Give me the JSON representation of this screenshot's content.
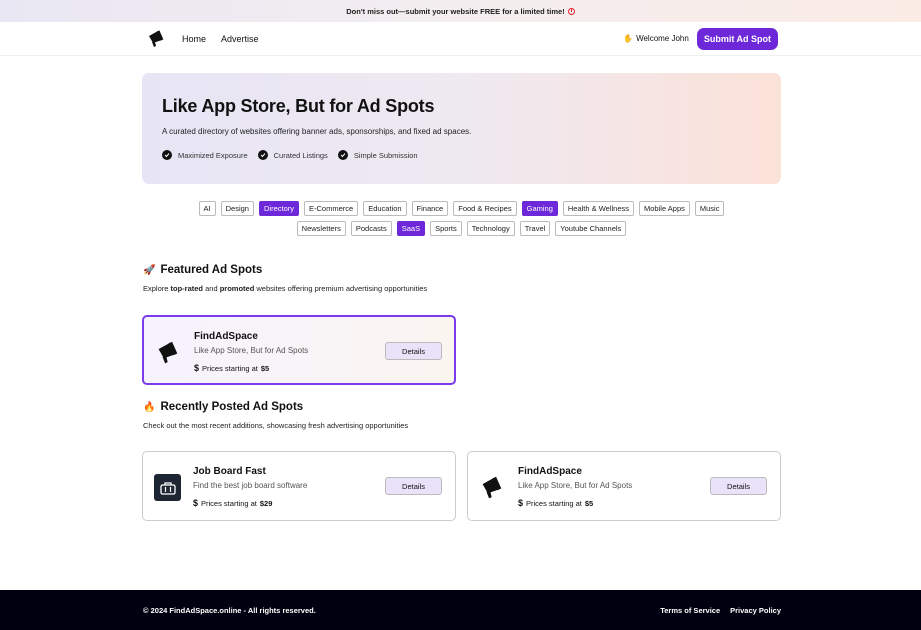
{
  "banner": {
    "text": "Don't miss out—submit your website FREE for a limited time!"
  },
  "nav": {
    "home": "Home",
    "advertise": "Advertise",
    "welcome": "Welcome John",
    "submit": "Submit Ad Spot"
  },
  "hero": {
    "title": "Like App Store, But for Ad Spots",
    "subtitle": "A curated directory of websites offering banner ads, sponsorships, and fixed ad spaces.",
    "features": [
      "Maximized Exposure",
      "Curated Listings",
      "Simple Submission"
    ]
  },
  "categories_row1": [
    "AI",
    "Design",
    "Directory",
    "E-Commerce",
    "Education",
    "Finance",
    "Food & Recipes",
    "Gaming",
    "Health & Wellness",
    "Mobile Apps",
    "Music"
  ],
  "categories_row2": [
    "Newsletters",
    "Podcasts",
    "SaaS",
    "Sports",
    "Technology",
    "Travel",
    "Youtube Channels"
  ],
  "active_categories": [
    "Directory",
    "Gaming",
    "SaaS"
  ],
  "featured": {
    "title": "Featured Ad Spots",
    "subtitle_pre": "Explore ",
    "subtitle_b1": "top-rated",
    "subtitle_mid": " and ",
    "subtitle_b2": "promoted",
    "subtitle_post": " websites offering premium advertising opportunities",
    "card": {
      "name": "FindAdSpace",
      "tagline": "Like App Store, But for Ad Spots",
      "price_label": "Prices starting at",
      "price": "$5",
      "button": "Details"
    }
  },
  "recent": {
    "title": "Recently Posted Ad Spots",
    "subtitle": "Check out the most recent additions, showcasing fresh advertising opportunities",
    "cards": [
      {
        "name": "Job Board Fast",
        "tagline": "Find the best job board software",
        "price_label": "Prices starting at",
        "price": "$29",
        "button": "Details"
      },
      {
        "name": "FindAdSpace",
        "tagline": "Like App Store, But for Ad Spots",
        "price_label": "Prices starting at",
        "price": "$5",
        "button": "Details"
      }
    ]
  },
  "footer": {
    "copyright": "© 2024 FindAdSpace.online - All rights reserved.",
    "terms": "Terms of Service",
    "privacy": "Privacy Policy"
  },
  "colors": {
    "accent": "#6d28d9",
    "footer_bg": "#000010"
  }
}
